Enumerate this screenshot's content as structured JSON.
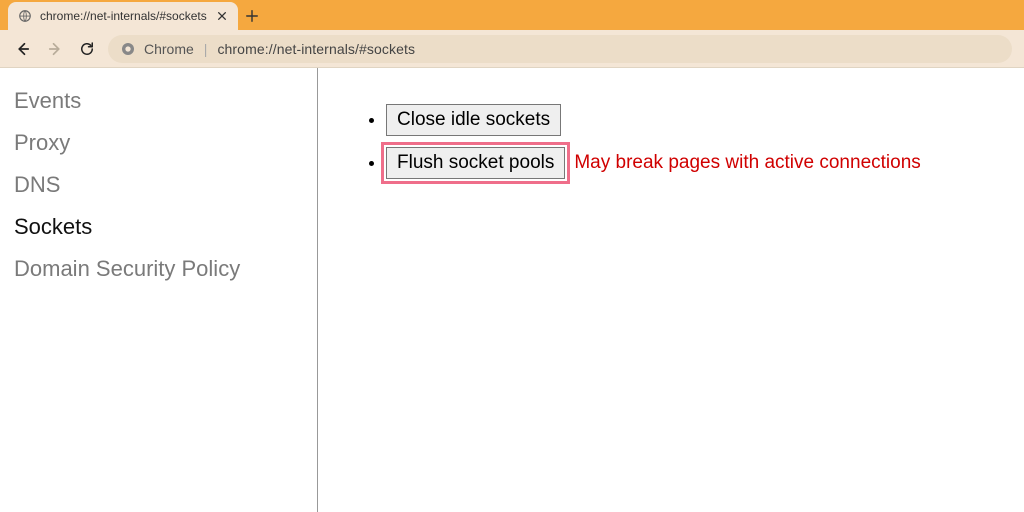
{
  "tab": {
    "title": "chrome://net-internals/#sockets"
  },
  "address_bar": {
    "scheme_label": "Chrome",
    "url": "chrome://net-internals/#sockets"
  },
  "sidebar": {
    "items": [
      {
        "label": "Events",
        "active": false
      },
      {
        "label": "Proxy",
        "active": false
      },
      {
        "label": "DNS",
        "active": false
      },
      {
        "label": "Sockets",
        "active": true
      },
      {
        "label": "Domain Security Policy",
        "active": false
      }
    ]
  },
  "main": {
    "buttons": {
      "close_idle": "Close idle sockets",
      "flush_pools": "Flush socket pools"
    },
    "flush_warning": "May break pages with active connections"
  },
  "colors": {
    "tabstrip": "#f5a83f",
    "toolbar": "#f4e6d6",
    "highlight_border": "#ef6e8a",
    "warning_text": "#d00000"
  }
}
